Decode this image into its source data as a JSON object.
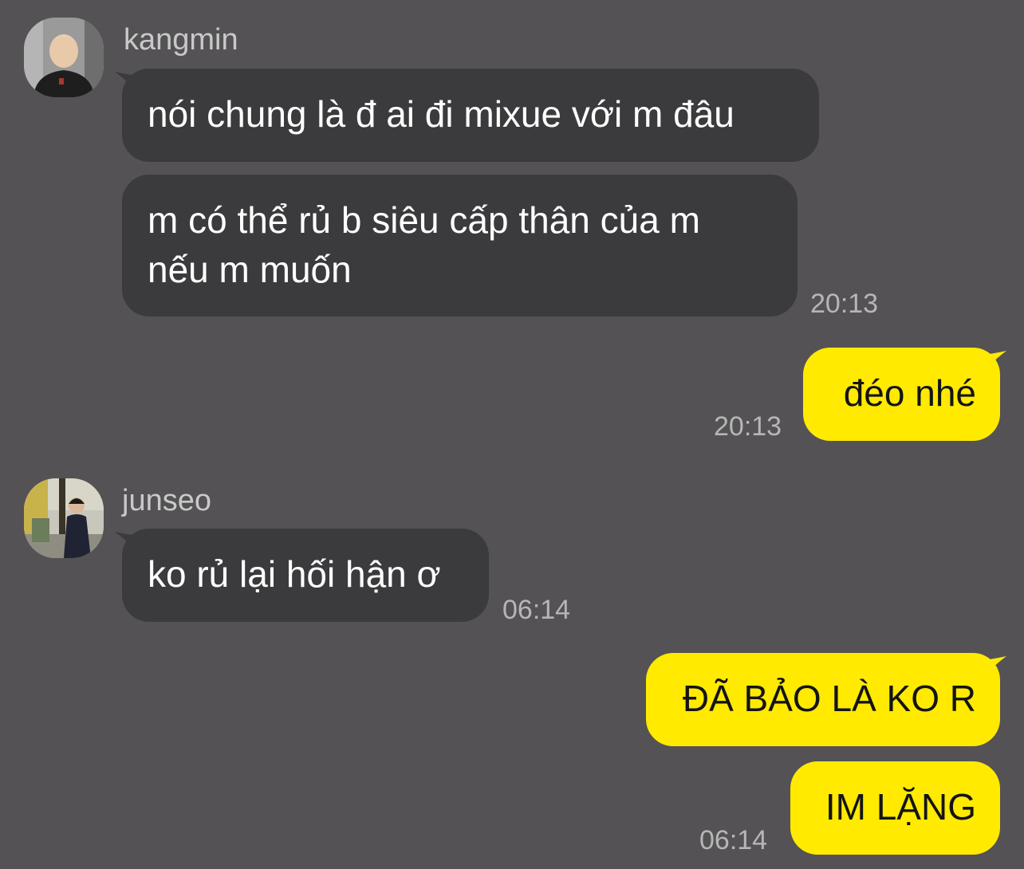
{
  "colors": {
    "background": "#545254",
    "incoming_bubble": "#3b3a3c",
    "outgoing_bubble": "#ffea00",
    "timestamp": "#b6b6b6",
    "sender_name": "#c9c9c9"
  },
  "messages": {
    "kangmin_group": {
      "sender": "kangmin",
      "avatar_icon": "profile-photo-icon",
      "bubble_1": "nói chung là đ ai đi mixue với m đâu",
      "bubble_2_line_1": "m có thể rủ b siêu cấp thân của m",
      "bubble_2_line_2": "nếu m muốn",
      "time": "20:13"
    },
    "reply_1": {
      "text": "đéo nhé",
      "time": "20:13"
    },
    "junseo_group": {
      "sender": "junseo",
      "avatar_icon": "profile-photo-icon",
      "bubble_1": "ko rủ lại hối hận ơ",
      "time": "06:14"
    },
    "reply_2": {
      "bubble_1": "ĐÃ BẢO LÀ KO R",
      "bubble_2": "IM LẶNG",
      "time": "06:14"
    }
  }
}
